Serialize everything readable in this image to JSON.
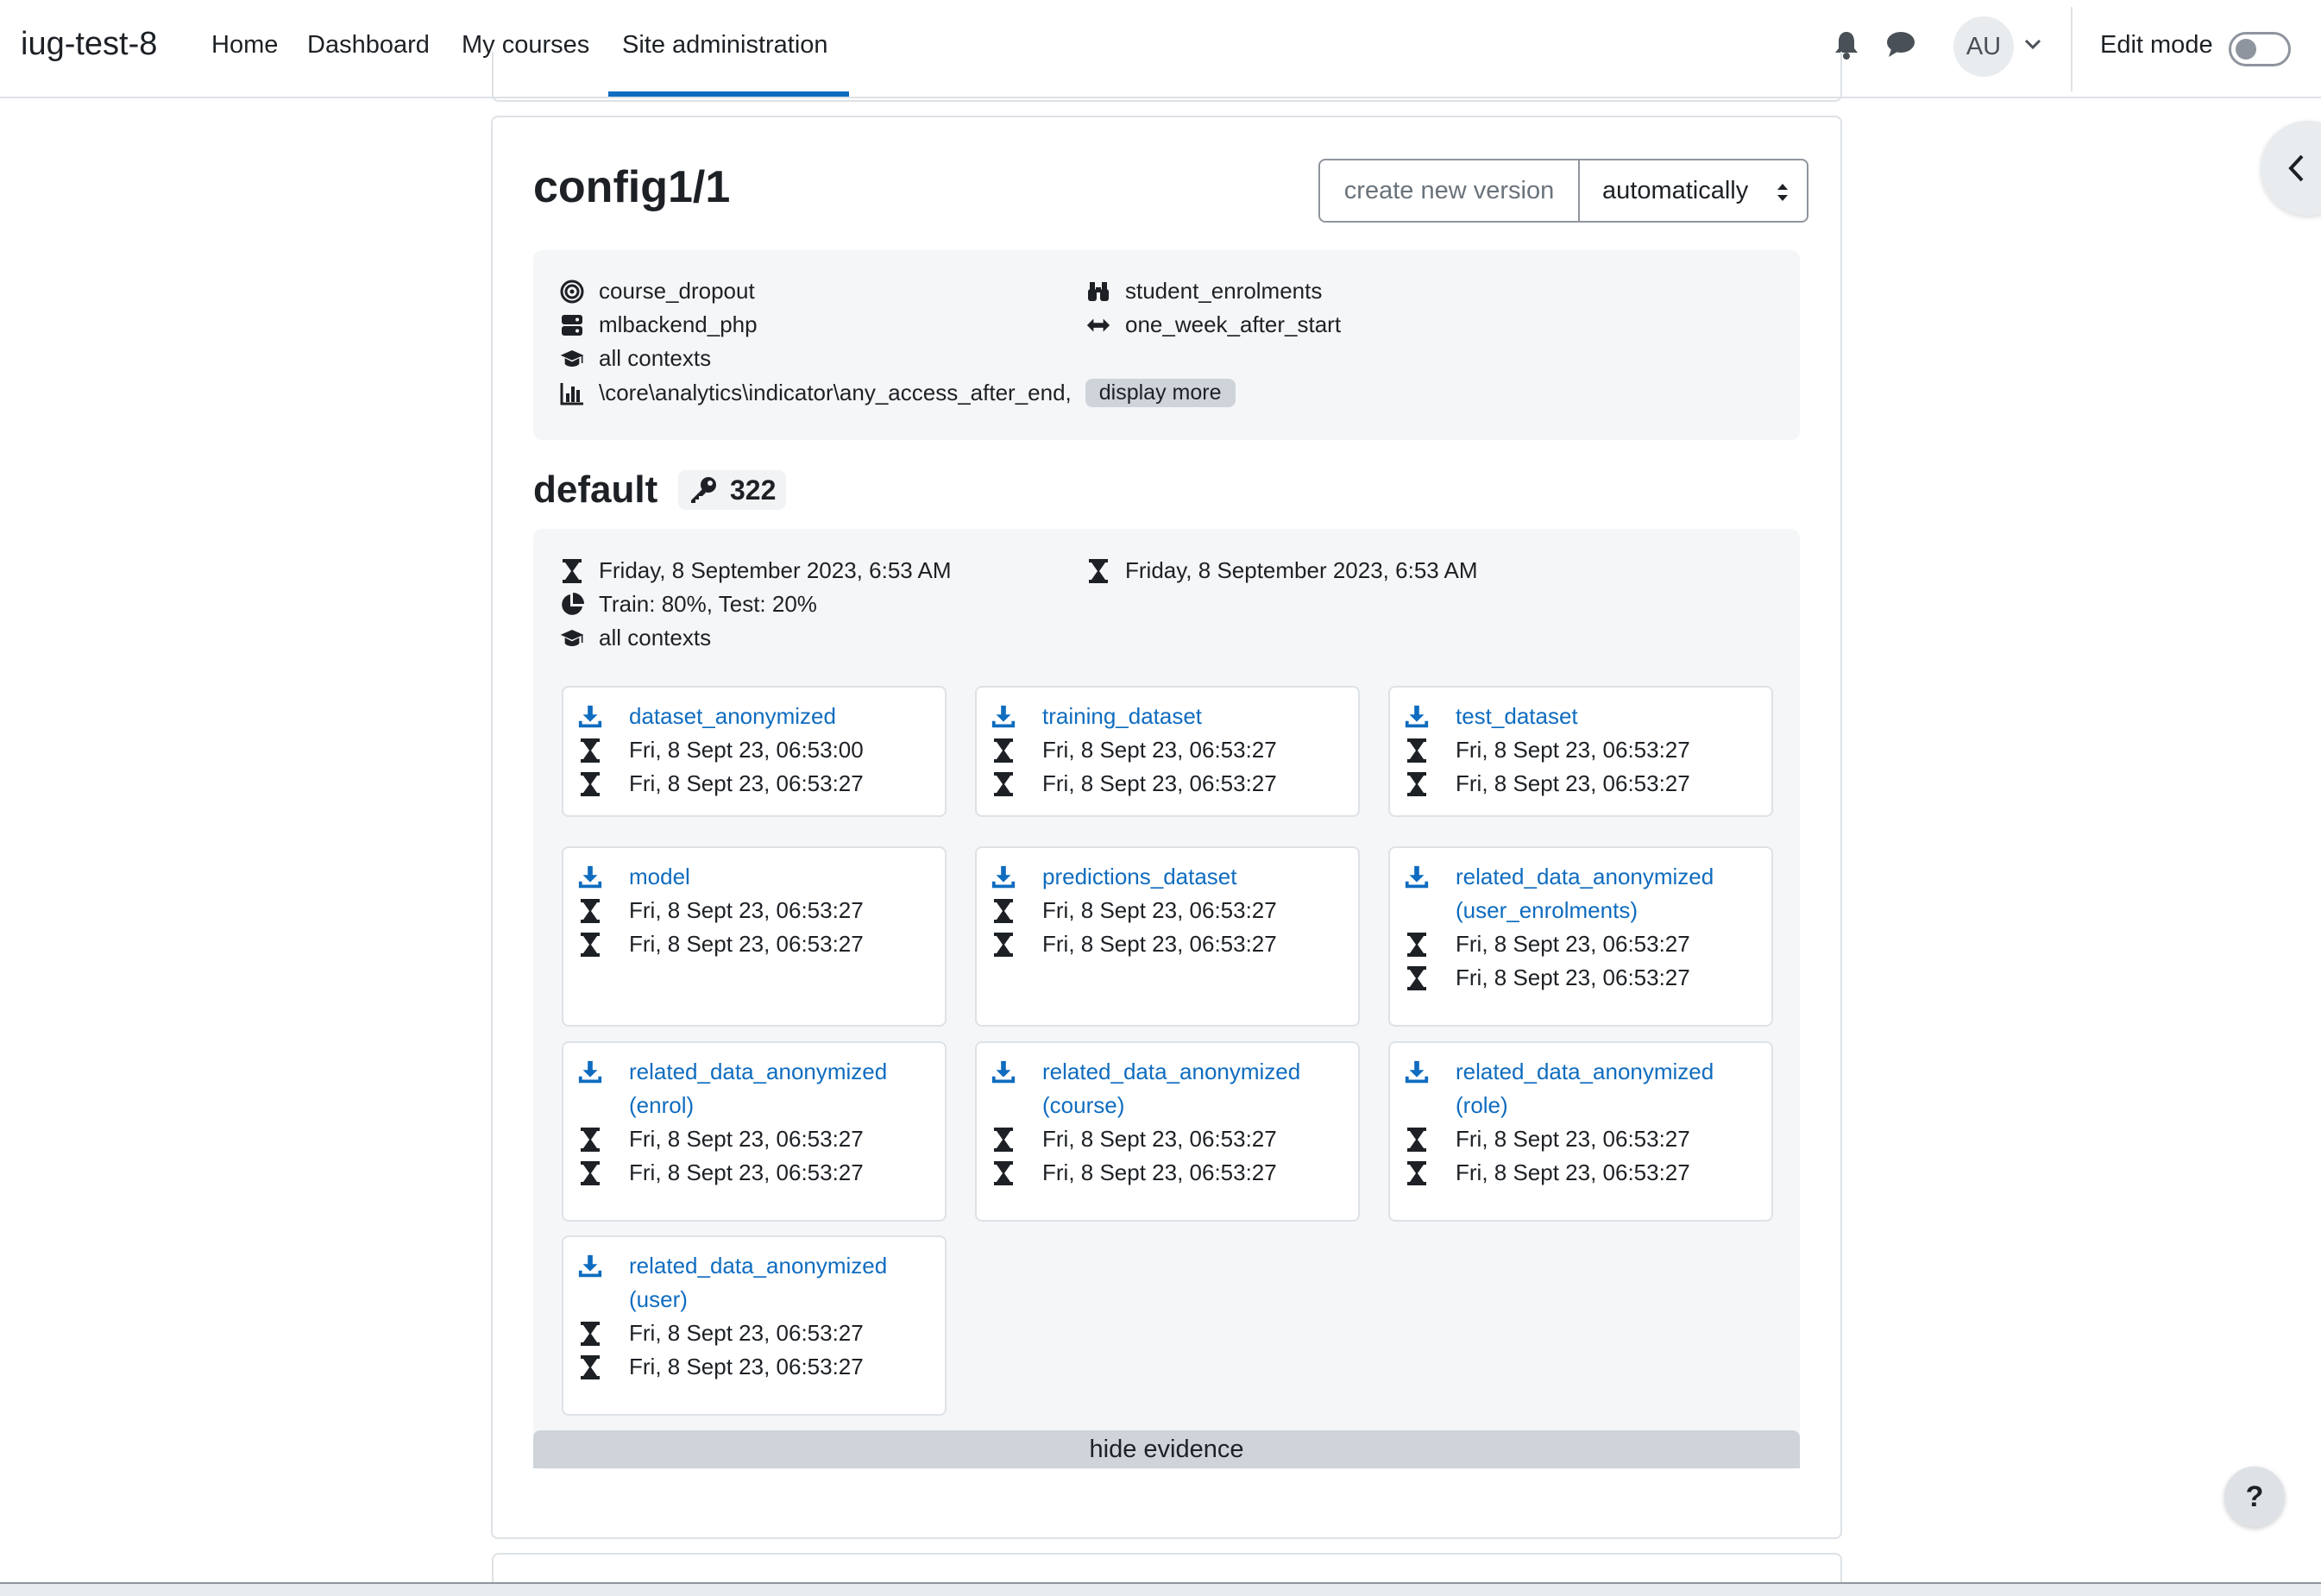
{
  "navbar": {
    "site_name": "iug-test-8",
    "links": [
      "Home",
      "Dashboard",
      "My courses",
      "Site administration"
    ],
    "active_link": "Site administration",
    "notifications_icon": "bell-icon",
    "messages_icon": "chat-bubble-icon",
    "user_initials": "AU",
    "user_menu_icon": "chevron-down-icon",
    "edit_mode_label": "Edit mode",
    "edit_mode_enabled": false
  },
  "drawer_toggle_icon": "chevron-left-icon",
  "help_button_label": "?",
  "model": {
    "title": "config1/1",
    "create_version_button": "create new version",
    "version_select_value": "automatically",
    "target": {
      "icon": "target-icon",
      "text": "course_dropout"
    },
    "analyser": {
      "icon": "binoculars-icon",
      "text": "student_enrolments"
    },
    "backend": {
      "icon": "server-icon",
      "text": "mlbackend_php"
    },
    "time_splitting": {
      "icon": "arrows-horizontal-icon",
      "text": "one_week_after_start"
    },
    "contexts": {
      "icon": "graduation-cap-icon",
      "text": "all contexts"
    },
    "indicators": {
      "icon": "bar-chart-icon",
      "text": "\\core\\analytics\\indicator\\any_access_after_end,"
    },
    "display_more_label": "display more"
  },
  "version": {
    "title": "default",
    "key_icon": "key-icon",
    "count": "322",
    "created": "Friday, 8 September 2023, 6:53 AM",
    "modified": "Friday, 8 September 2023, 6:53 AM",
    "split": "Train: 80%, Test: 20%",
    "contexts": "all contexts",
    "hide_evidence_label": "hide evidence"
  },
  "evidence": [
    {
      "name": "dataset_anonymized",
      "start": "Fri, 8 Sept 23, 06:53:00",
      "end": "Fri, 8 Sept 23, 06:53:27"
    },
    {
      "name": "training_dataset",
      "start": "Fri, 8 Sept 23, 06:53:27",
      "end": "Fri, 8 Sept 23, 06:53:27"
    },
    {
      "name": "test_dataset",
      "start": "Fri, 8 Sept 23, 06:53:27",
      "end": "Fri, 8 Sept 23, 06:53:27"
    },
    {
      "name": "model",
      "start": "Fri, 8 Sept 23, 06:53:27",
      "end": "Fri, 8 Sept 23, 06:53:27"
    },
    {
      "name": "predictions_dataset",
      "start": "Fri, 8 Sept 23, 06:53:27",
      "end": "Fri, 8 Sept 23, 06:53:27"
    },
    {
      "name": "related_data_anonymized",
      "qualifier": "(user_enrolments)",
      "start": "Fri, 8 Sept 23, 06:53:27",
      "end": "Fri, 8 Sept 23, 06:53:27"
    },
    {
      "name": "related_data_anonymized",
      "qualifier": "(enrol)",
      "start": "Fri, 8 Sept 23, 06:53:27",
      "end": "Fri, 8 Sept 23, 06:53:27"
    },
    {
      "name": "related_data_anonymized",
      "qualifier": "(course)",
      "start": "Fri, 8 Sept 23, 06:53:27",
      "end": "Fri, 8 Sept 23, 06:53:27"
    },
    {
      "name": "related_data_anonymized",
      "qualifier": "(role)",
      "start": "Fri, 8 Sept 23, 06:53:27",
      "end": "Fri, 8 Sept 23, 06:53:27"
    },
    {
      "name": "related_data_anonymized",
      "qualifier": "(user)",
      "start": "Fri, 8 Sept 23, 06:53:27",
      "end": "Fri, 8 Sept 23, 06:53:27"
    }
  ],
  "colors": {
    "link": "#0f6cbf",
    "active_tab": "#0f6cbf",
    "panel_bg": "#f5f6f7",
    "badge_bg": "#ced4da"
  }
}
